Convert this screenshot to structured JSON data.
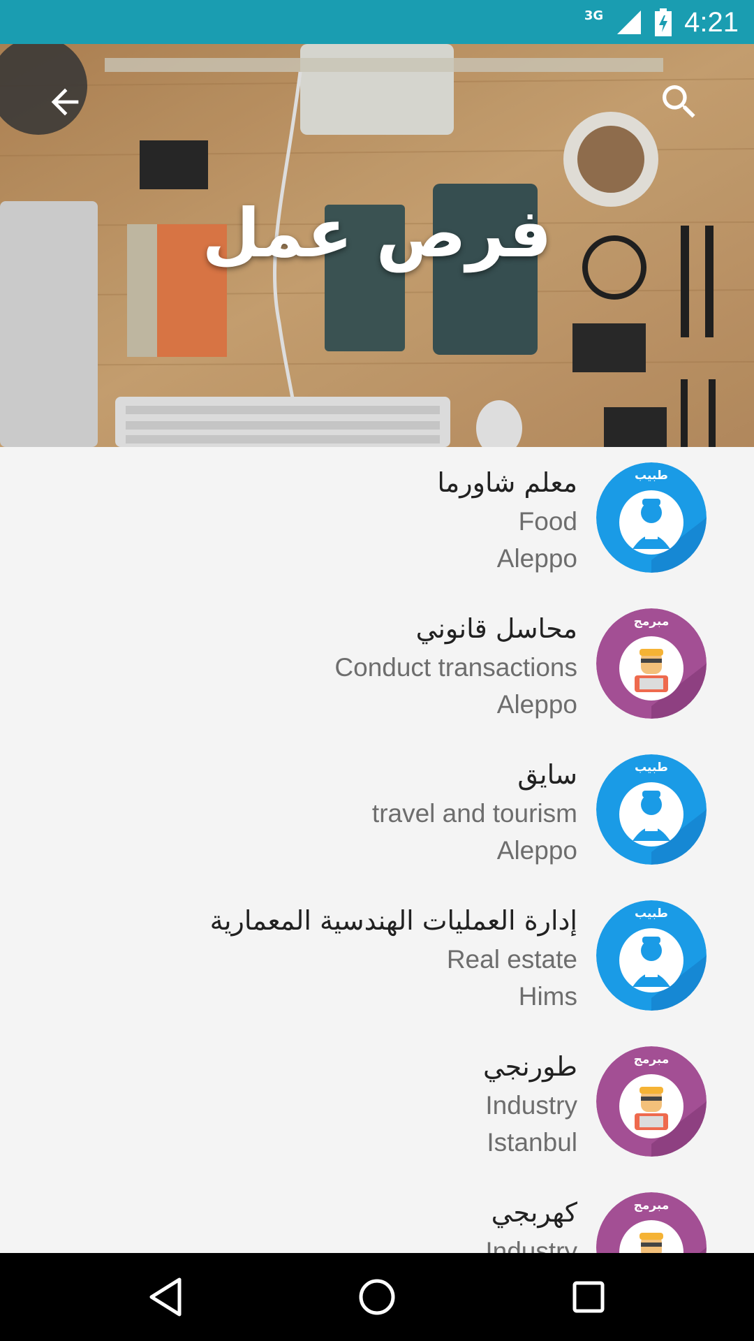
{
  "status_bar": {
    "network": "3G",
    "time": "4:21"
  },
  "header": {
    "title": "فرص عمل",
    "back_icon": "arrow-back-icon",
    "search_icon": "search-icon"
  },
  "jobs": [
    {
      "title": "معلم شاورما",
      "category": "Food",
      "location": "Aleppo",
      "avatar": "doctor",
      "avatar_label": "طبيب",
      "color": "#1a9be6"
    },
    {
      "title": "محاسل قانوني",
      "category": "Conduct transactions",
      "location": "Aleppo",
      "avatar": "programmer",
      "avatar_label": "مبرمج",
      "color": "#a34f94"
    },
    {
      "title": "سايق",
      "category": "travel and tourism",
      "location": "Aleppo",
      "avatar": "doctor",
      "avatar_label": "طبيب",
      "color": "#1a9be6"
    },
    {
      "title": "إدارة العمليات الهندسية المعمارية",
      "category": "Real estate",
      "location": "Hims",
      "avatar": "doctor",
      "avatar_label": "طبيب",
      "color": "#1a9be6"
    },
    {
      "title": "طورنجي",
      "category": "Industry",
      "location": "Istanbul",
      "avatar": "programmer",
      "avatar_label": "مبرمج",
      "color": "#a34f94"
    },
    {
      "title": "كهربجي",
      "category": "Industry",
      "location": "",
      "avatar": "programmer",
      "avatar_label": "مبرمج",
      "color": "#a34f94"
    }
  ],
  "nav": {
    "back_icon": "nav-back-icon",
    "home_icon": "nav-home-icon",
    "recents_icon": "nav-recents-icon"
  }
}
